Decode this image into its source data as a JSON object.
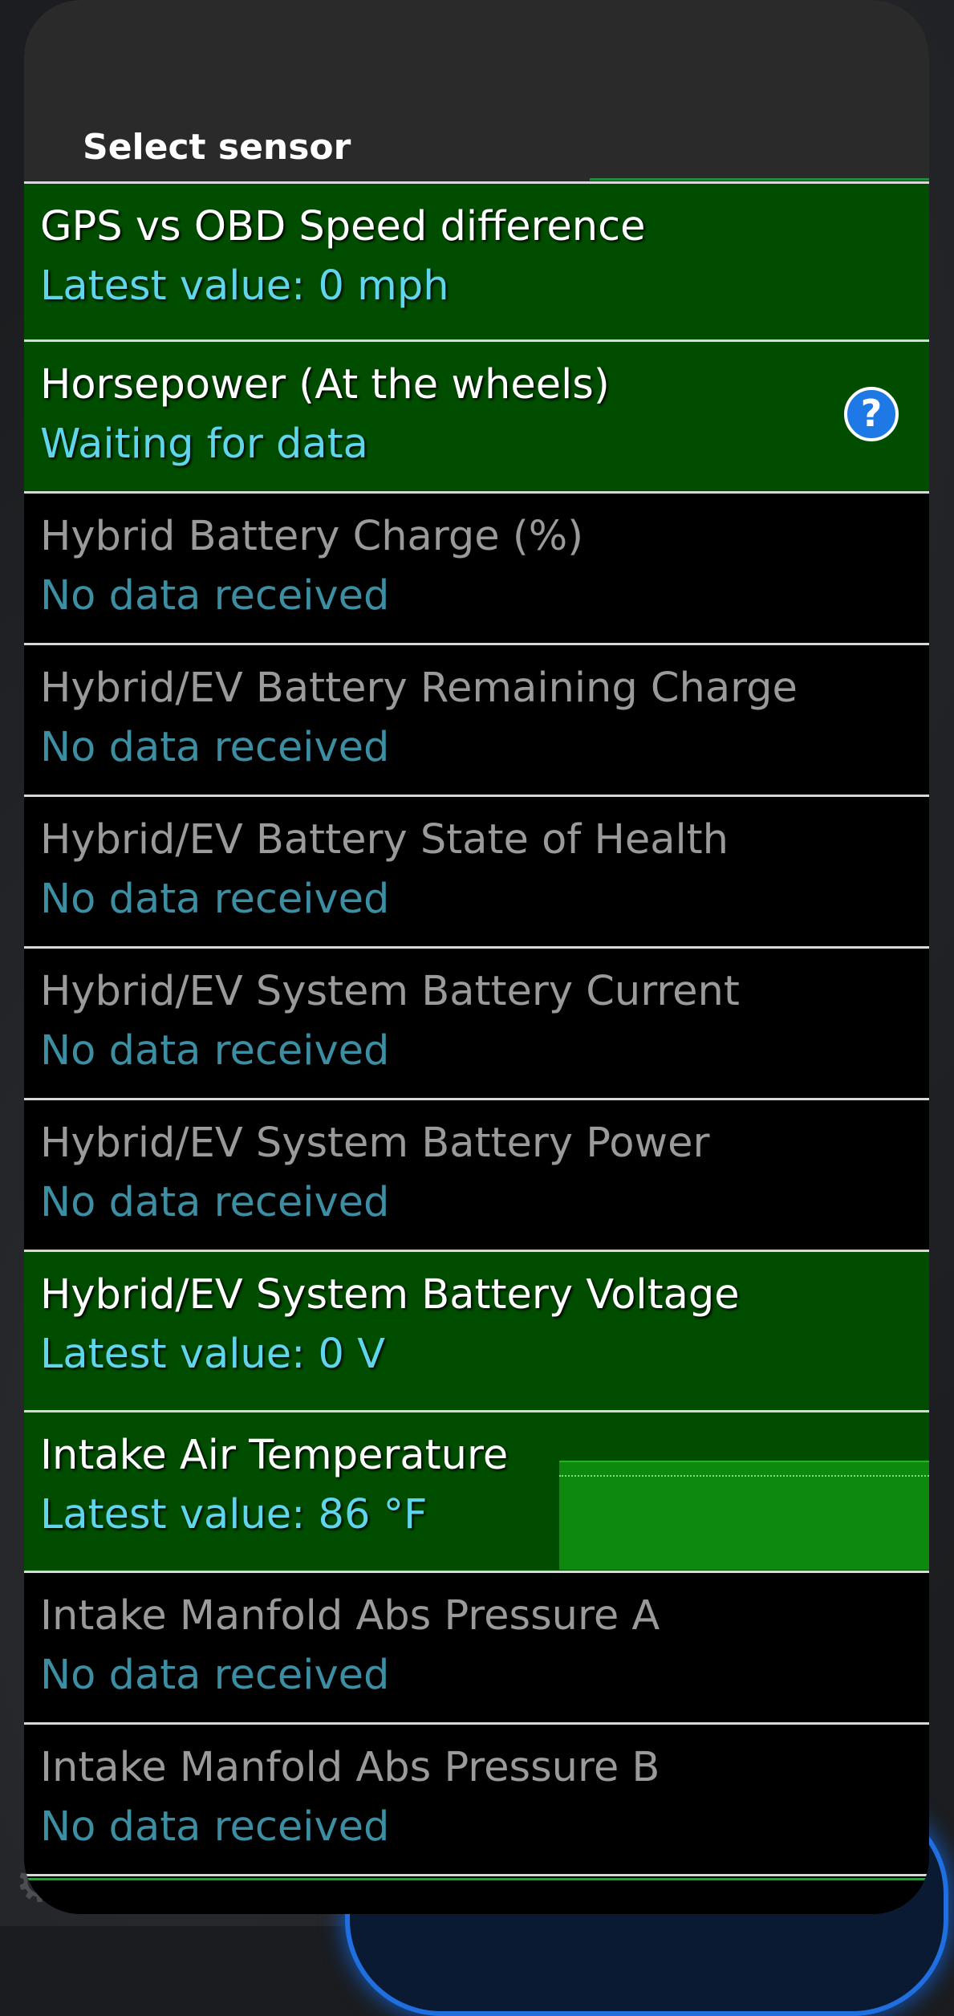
{
  "dialog": {
    "title": "Select sensor"
  },
  "colors": {
    "active_row": "#004d00",
    "inactive_row": "#000000",
    "active_status": "#5fd6ec",
    "inactive_status": "#3c8ea3",
    "help_icon": "#1e78e6"
  },
  "icons": {
    "help": "question-circle-icon",
    "background_gear": "gear-icon"
  },
  "sensors": [
    {
      "name": "GPS vs OBD Speed difference",
      "status": "Latest value: 0 mph",
      "active": true
    },
    {
      "name": "Horsepower (At the wheels)",
      "status": "Waiting for data",
      "active": true,
      "help": "?"
    },
    {
      "name": "Hybrid Battery Charge (%)",
      "status": "No data received",
      "active": false
    },
    {
      "name": "Hybrid/EV Battery Remaining Charge",
      "status": "No data received",
      "active": false
    },
    {
      "name": "Hybrid/EV Battery State of Health",
      "status": "No data received",
      "active": false
    },
    {
      "name": "Hybrid/EV System Battery Current",
      "status": "No data received",
      "active": false
    },
    {
      "name": "Hybrid/EV System Battery Power",
      "status": "No data received",
      "active": false
    },
    {
      "name": "Hybrid/EV System Battery Voltage",
      "status": "Latest value: 0 V",
      "active": true
    },
    {
      "name": "Intake Air Temperature",
      "status": "Latest value: 86 °F",
      "active": true,
      "has_sparkline": true
    },
    {
      "name": "Intake Manfold Abs Pressure A",
      "status": "No data received",
      "active": false
    },
    {
      "name": "Intake Manfold Abs Pressure B",
      "status": "No data received",
      "active": false
    }
  ]
}
